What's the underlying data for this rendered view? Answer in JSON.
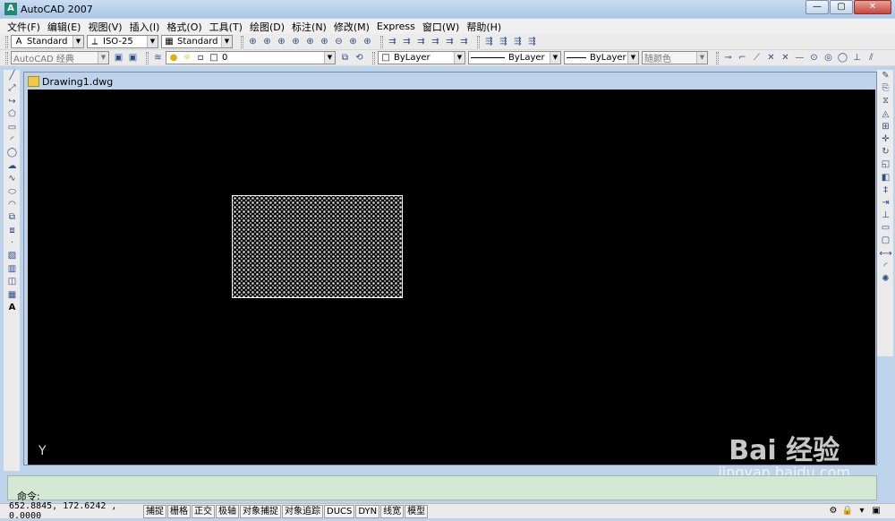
{
  "window": {
    "title": "AutoCAD 2007",
    "buttons": [
      "—",
      "▢",
      "✕"
    ]
  },
  "menus": [
    "文件(F)",
    "编辑(E)",
    "视图(V)",
    "插入(I)",
    "格式(O)",
    "工具(T)",
    "绘图(D)",
    "标注(N)",
    "修改(M)",
    "Express",
    "窗口(W)",
    "帮助(H)"
  ],
  "styles": {
    "text_style": "Standard",
    "dim_style": "ISO-25",
    "table_style": "Standard"
  },
  "workspace": "AutoCAD 经典",
  "layer": "0",
  "properties": {
    "color": "ByLayer",
    "linetype": "ByLayer",
    "lineweight": "ByLayer",
    "plot_style": "随颜色"
  },
  "document": {
    "tab_title": "Drawing1.dwg"
  },
  "ucs_label": "Y",
  "command": {
    "prompt": "命令:"
  },
  "status": {
    "coordinates": "652.8845,  172.6242 ,  0.0000",
    "toggles": [
      "捕捉",
      "栅格",
      "正交",
      "极轴",
      "对象捕捉",
      "对象追踪",
      "DUCS",
      "DYN",
      "线宽",
      "模型"
    ]
  },
  "watermark": {
    "main": "Bai 经验",
    "sub": "jingyan.baidu.com"
  },
  "icons": {
    "toolbar_row1": [
      "zoom-realtime-icon",
      "zoom-window-icon",
      "zoom-dynamic-icon",
      "zoom-scale-icon",
      "zoom-center-icon",
      "zoom-in-icon",
      "zoom-out-icon",
      "zoom-all-icon",
      "zoom-extents-icon"
    ],
    "left_draw": [
      "line-icon",
      "construction-line-icon",
      "polyline-icon",
      "polygon-icon",
      "rectangle-icon",
      "arc-icon",
      "circle-icon",
      "revcloud-icon",
      "spline-icon",
      "ellipse-icon",
      "ellipse-arc-icon",
      "insert-block-icon",
      "make-block-icon",
      "point-icon",
      "hatch-icon",
      "gradient-icon",
      "region-icon",
      "table-icon",
      "mtext-icon"
    ],
    "right_modify": [
      "erase-icon",
      "copy-icon",
      "mirror-icon",
      "offset-icon",
      "array-icon",
      "move-icon",
      "rotate-icon",
      "scale-icon",
      "stretch-icon",
      "trim-icon",
      "extend-icon",
      "break-at-point-icon",
      "break-icon",
      "join-icon",
      "chamfer-icon",
      "fillet-icon",
      "explode-icon"
    ]
  }
}
